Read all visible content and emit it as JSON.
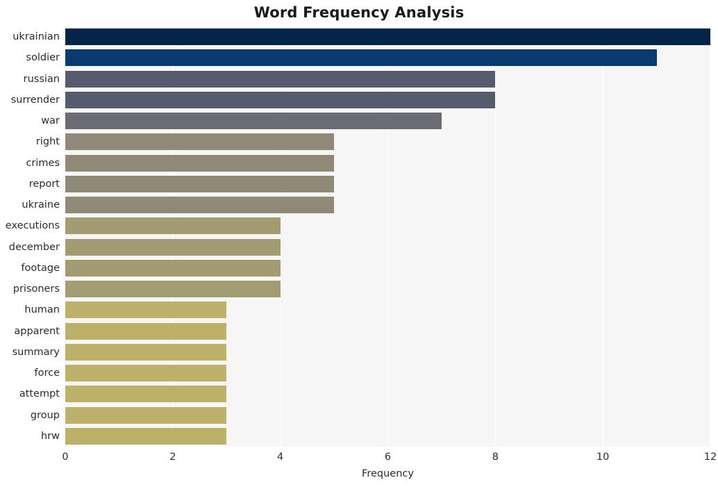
{
  "chart_data": {
    "type": "bar",
    "orientation": "horizontal",
    "title": "Word Frequency Analysis",
    "xlabel": "Frequency",
    "ylabel": "",
    "xlim": [
      0,
      12
    ],
    "xticks": [
      0,
      2,
      4,
      6,
      8,
      10,
      12
    ],
    "grid": true,
    "legend": false,
    "categories": [
      "ukrainian",
      "soldier",
      "russian",
      "surrender",
      "war",
      "right",
      "crimes",
      "report",
      "ukraine",
      "executions",
      "december",
      "footage",
      "prisoners",
      "human",
      "apparent",
      "summary",
      "force",
      "attempt",
      "group",
      "hrw"
    ],
    "values": [
      12,
      11,
      8,
      8,
      7,
      5,
      5,
      5,
      5,
      4,
      4,
      4,
      4,
      3,
      3,
      3,
      3,
      3,
      3,
      3
    ],
    "bar_colors": [
      "#042449",
      "#0a3a72",
      "#565b70",
      "#565b70",
      "#6a6b73",
      "#8f8a77",
      "#8f8a77",
      "#8f8a77",
      "#8f8a77",
      "#a49c71",
      "#a49c71",
      "#a49c71",
      "#a49c71",
      "#bdb169",
      "#bdb169",
      "#bdb169",
      "#bdb169",
      "#bdb169",
      "#bdb169",
      "#bdb169"
    ],
    "plot_background": "#f6f6f7",
    "gridline_color": "#ffffff"
  }
}
